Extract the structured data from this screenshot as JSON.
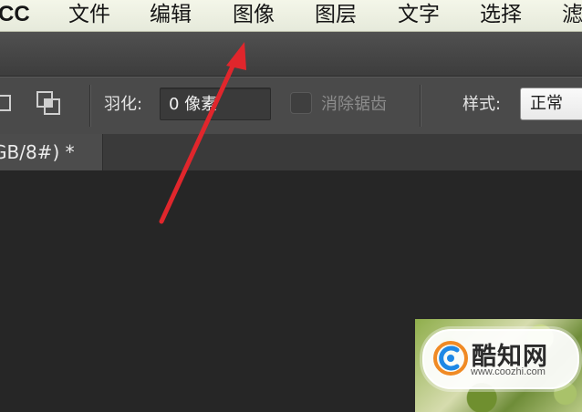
{
  "menubar": {
    "app_name_partial": "CC",
    "items": [
      "文件",
      "编辑",
      "图像",
      "图层",
      "文字",
      "选择",
      "滤"
    ]
  },
  "options_bar": {
    "feather_label": "羽化:",
    "feather_value": "0 像素",
    "antialias_label": "消除锯齿",
    "antialias_checked": false,
    "style_label": "样式:",
    "style_value": "正常"
  },
  "document_tab": {
    "title_partial": "GB/8#) *"
  },
  "watermark": {
    "name": "酷知网",
    "url": "www.coozhi.com"
  },
  "colors": {
    "menubar_bg": "#eef0e2",
    "panel_bg": "#4a4a4a",
    "canvas_bg": "#262626",
    "arrow": "#e0262c",
    "watermark_logo": "#1e88e5"
  }
}
